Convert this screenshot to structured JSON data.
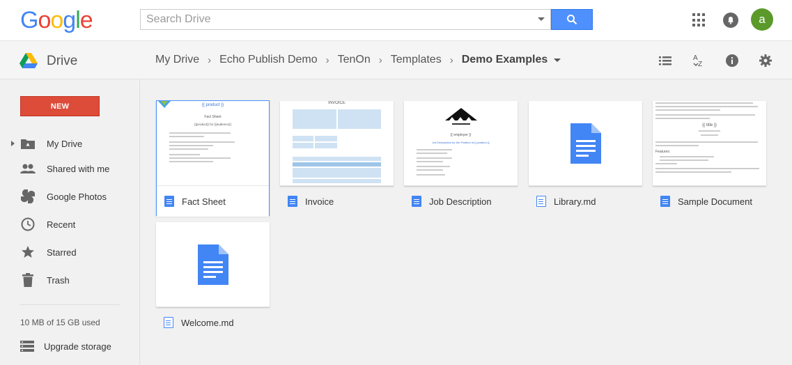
{
  "app": {
    "logo_text": "Google",
    "drive_title": "Drive"
  },
  "search": {
    "placeholder": "Search Drive"
  },
  "account": {
    "avatar_letter": "a"
  },
  "breadcrumb": {
    "items": [
      "My Drive",
      "Echo Publish Demo",
      "TenOn",
      "Templates"
    ],
    "current": "Demo Examples"
  },
  "sidebar": {
    "new_label": "NEW",
    "items": [
      {
        "label": "My Drive",
        "icon": "my-drive-icon"
      },
      {
        "label": "Shared with me",
        "icon": "shared-icon"
      },
      {
        "label": "Google Photos",
        "icon": "photos-icon"
      },
      {
        "label": "Recent",
        "icon": "clock-icon"
      },
      {
        "label": "Starred",
        "icon": "star-icon"
      },
      {
        "label": "Trash",
        "icon": "trash-icon"
      }
    ],
    "quota": "10 MB of 15 GB used",
    "upgrade_label": "Upgrade storage"
  },
  "files": [
    {
      "name": "Fact Sheet",
      "type": "doc",
      "selected": true
    },
    {
      "name": "Invoice",
      "type": "doc"
    },
    {
      "name": "Job Description",
      "type": "doc"
    },
    {
      "name": "Library.md",
      "type": "text"
    },
    {
      "name": "Sample Document",
      "type": "doc"
    },
    {
      "name": "Welcome.md",
      "type": "text"
    }
  ],
  "thumbs": {
    "fact_sheet": {
      "title": "{{ product }}",
      "heading": "Fact Sheet",
      "sub": "{{product}} for {{audience}}"
    },
    "invoice": {
      "title": "INVOICE"
    },
    "job": {
      "employer": "{{ employer }}",
      "line": "Job Description for the Position of {{ position }}"
    },
    "sample": {
      "title": "{{ title }}",
      "features": "Features:"
    }
  },
  "colors": {
    "accent": "#4d90fe",
    "new_button": "#dd4b39",
    "avatar": "#5b9a2a",
    "doc_blue": "#4285f4"
  }
}
